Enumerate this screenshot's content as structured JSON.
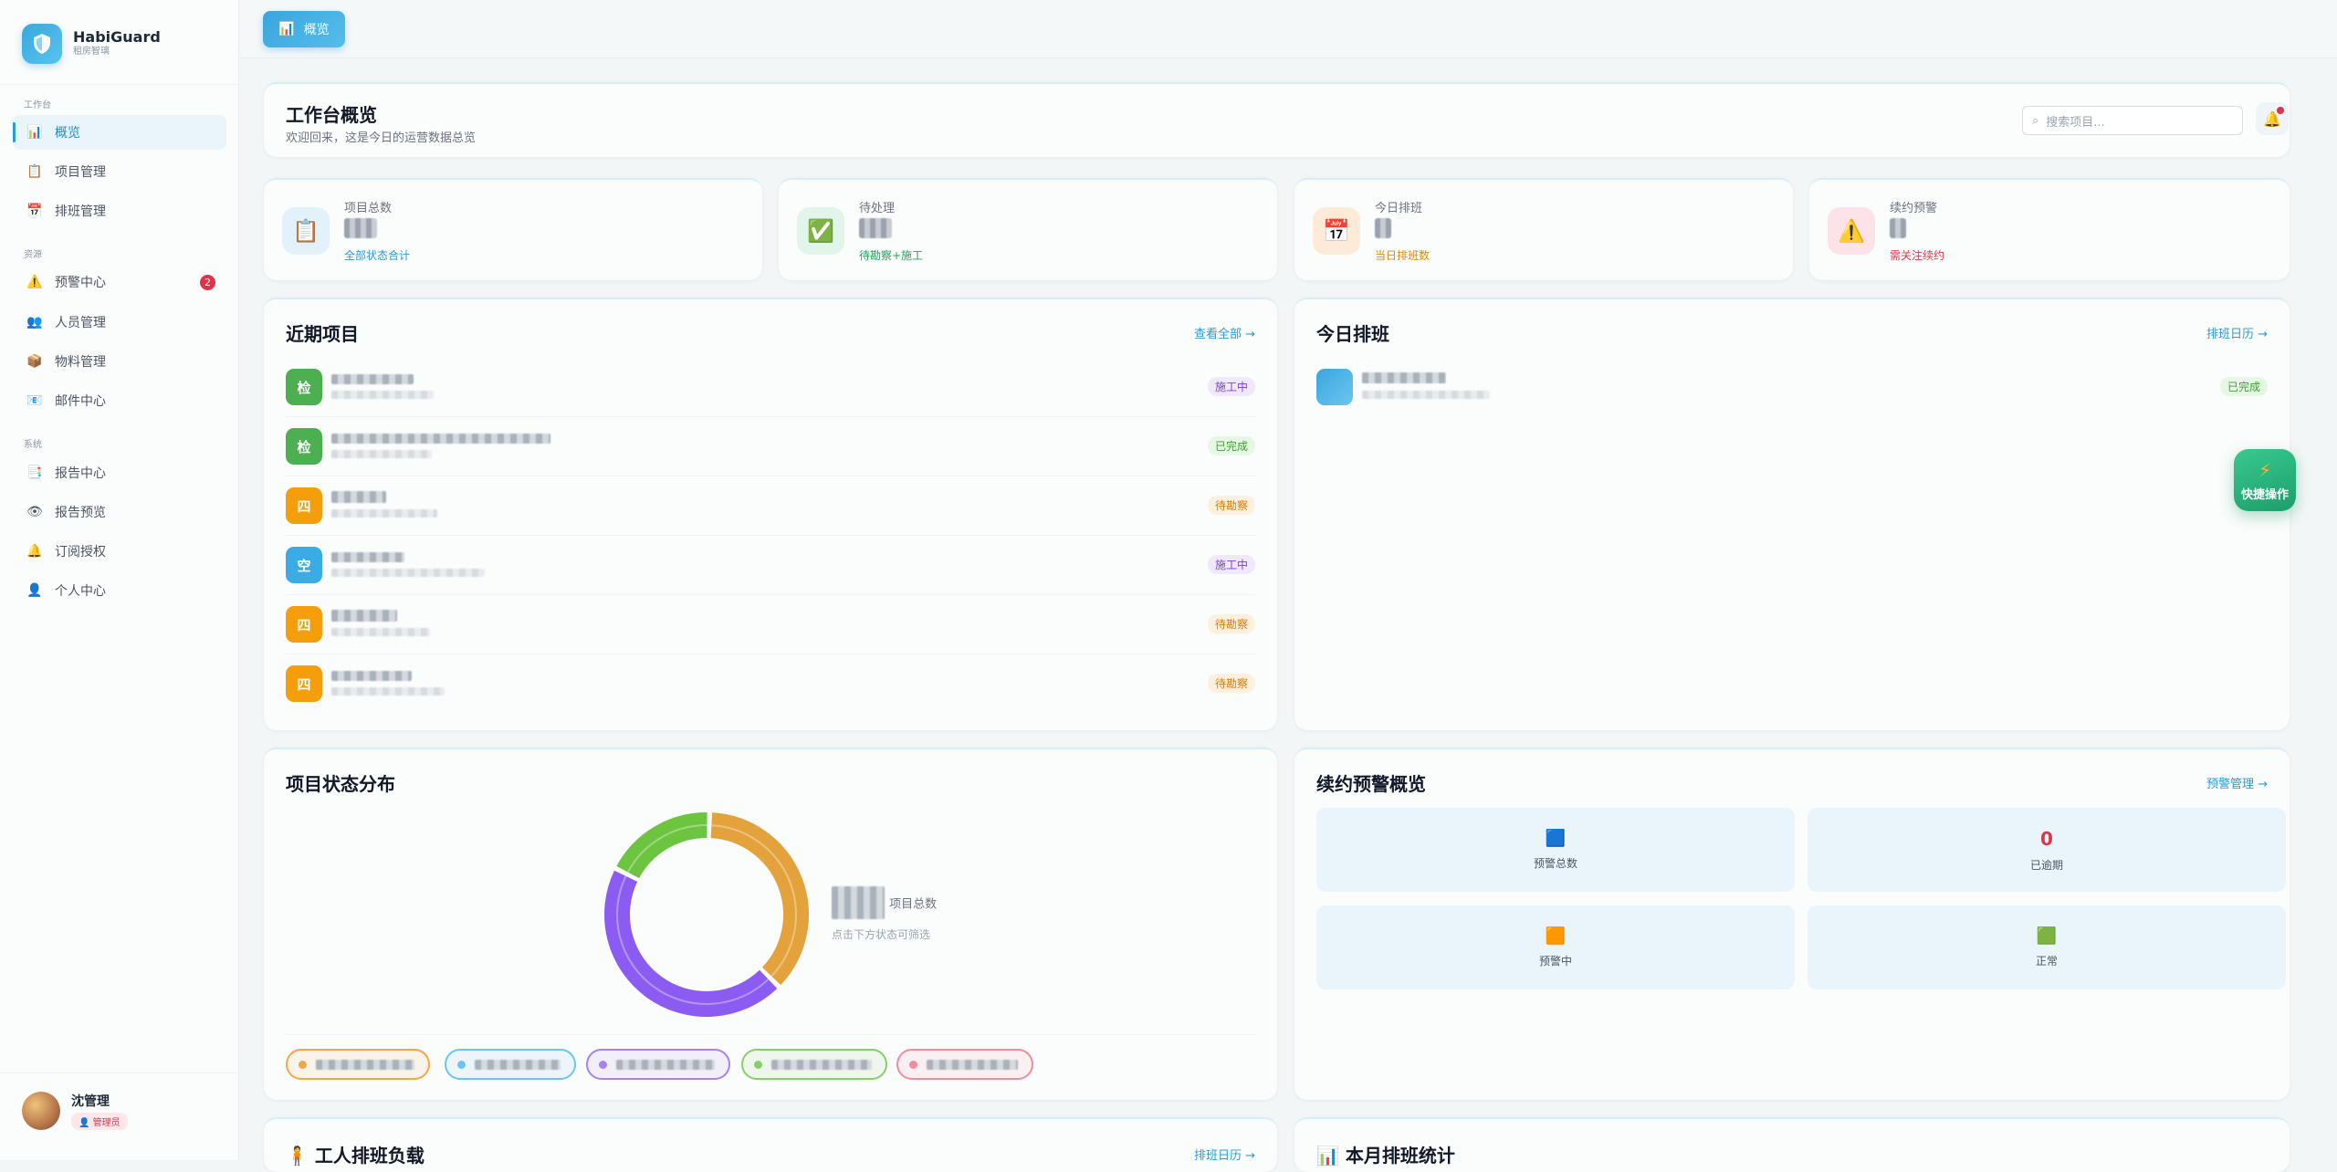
{
  "app": {
    "name": "HabiGuard",
    "subtitle": "租房智璃"
  },
  "sidebar": {
    "sections": [
      {
        "label": "工作台"
      },
      {
        "label": "资源"
      },
      {
        "label": "系统"
      }
    ],
    "items": [
      {
        "label": "概览",
        "icon": "chart-icon"
      },
      {
        "label": "项目管理",
        "icon": "clipboard-icon"
      },
      {
        "label": "排班管理",
        "icon": "calendar-icon"
      },
      {
        "label": "预警中心",
        "icon": "warning-icon",
        "badge": "2"
      },
      {
        "label": "人员管理",
        "icon": "people-icon"
      },
      {
        "label": "物料管理",
        "icon": "box-icon"
      },
      {
        "label": "邮件中心",
        "icon": "mail-icon"
      },
      {
        "label": "报告中心",
        "icon": "report-icon"
      },
      {
        "label": "报告预览",
        "icon": "eye-icon"
      },
      {
        "label": "订阅授权",
        "icon": "bell-icon"
      },
      {
        "label": "个人中心",
        "icon": "user-icon"
      }
    ],
    "user": {
      "name": "沈管理",
      "role": "管理员"
    }
  },
  "topbar": {
    "active_tab": "概览"
  },
  "header": {
    "title": "工作台概览",
    "subtitle": "欢迎回来，这是今日的运营数据总览",
    "search_placeholder": "搜索项目..."
  },
  "stats": [
    {
      "label": "项目总数",
      "sub": "全部状态合计",
      "sub_color": "#2a9bd6"
    },
    {
      "label": "待处理",
      "sub": "待勘察+施工",
      "sub_color": "#20a35a"
    },
    {
      "label": "今日排班",
      "sub": "当日排班数",
      "sub_color": "#e08a12"
    },
    {
      "label": "续约预警",
      "sub": "需关注续约",
      "sub_color": "#d33a4e"
    }
  ],
  "recent_projects": {
    "title": "近期项目",
    "link": "查看全部 →",
    "rows": [
      {
        "avatar": "检",
        "color": "#4caf50",
        "status": "施工中",
        "status_style": "purple"
      },
      {
        "avatar": "检",
        "color": "#4caf50",
        "status": "已完成",
        "status_style": "green"
      },
      {
        "avatar": "四",
        "color": "#f59e0b",
        "status": "待勘察",
        "status_style": "orange"
      },
      {
        "avatar": "空",
        "color": "#3aabe4",
        "status": "施工中",
        "status_style": "purple"
      },
      {
        "avatar": "四",
        "color": "#f59e0b",
        "status": "待勘察",
        "status_style": "orange"
      },
      {
        "avatar": "四",
        "color": "#f59e0b",
        "status": "待勘察",
        "status_style": "orange"
      }
    ]
  },
  "today_schedule": {
    "title": "今日排班",
    "link": "排班日历 →",
    "rows": [
      {
        "status": "已完成"
      }
    ]
  },
  "status_distribution": {
    "title": "项目状态分布",
    "center_label": "项目总数",
    "hint": "点击下方状态可筛选"
  },
  "chart_data": {
    "type": "pie",
    "title": "项目状态分布",
    "segments": [
      {
        "value": 37,
        "color": "#e4a23d"
      },
      {
        "value": 45,
        "color": "#8c5cf2"
      },
      {
        "value": 18,
        "color": "#6cc43f"
      }
    ],
    "legend_colors": [
      "#f0a844",
      "#6ec4ee",
      "#a682f4",
      "#88cf6a",
      "#f28b9c"
    ]
  },
  "renewal_alerts": {
    "title": "续约预警概览",
    "link": "预警管理 →",
    "tiles": [
      {
        "label": "预警总数",
        "icon": "square-icon"
      },
      {
        "label": "已逾期",
        "icon": "circle-icon",
        "value": "0"
      },
      {
        "label": "预警中",
        "icon": "square-icon"
      },
      {
        "label": "正常",
        "icon": "square-icon"
      }
    ]
  },
  "worker_load": {
    "title": "工人排班负载",
    "link": "排班日历 →"
  },
  "monthly_stats": {
    "title": "本月排班统计"
  },
  "fab": {
    "label": "快捷操作"
  }
}
